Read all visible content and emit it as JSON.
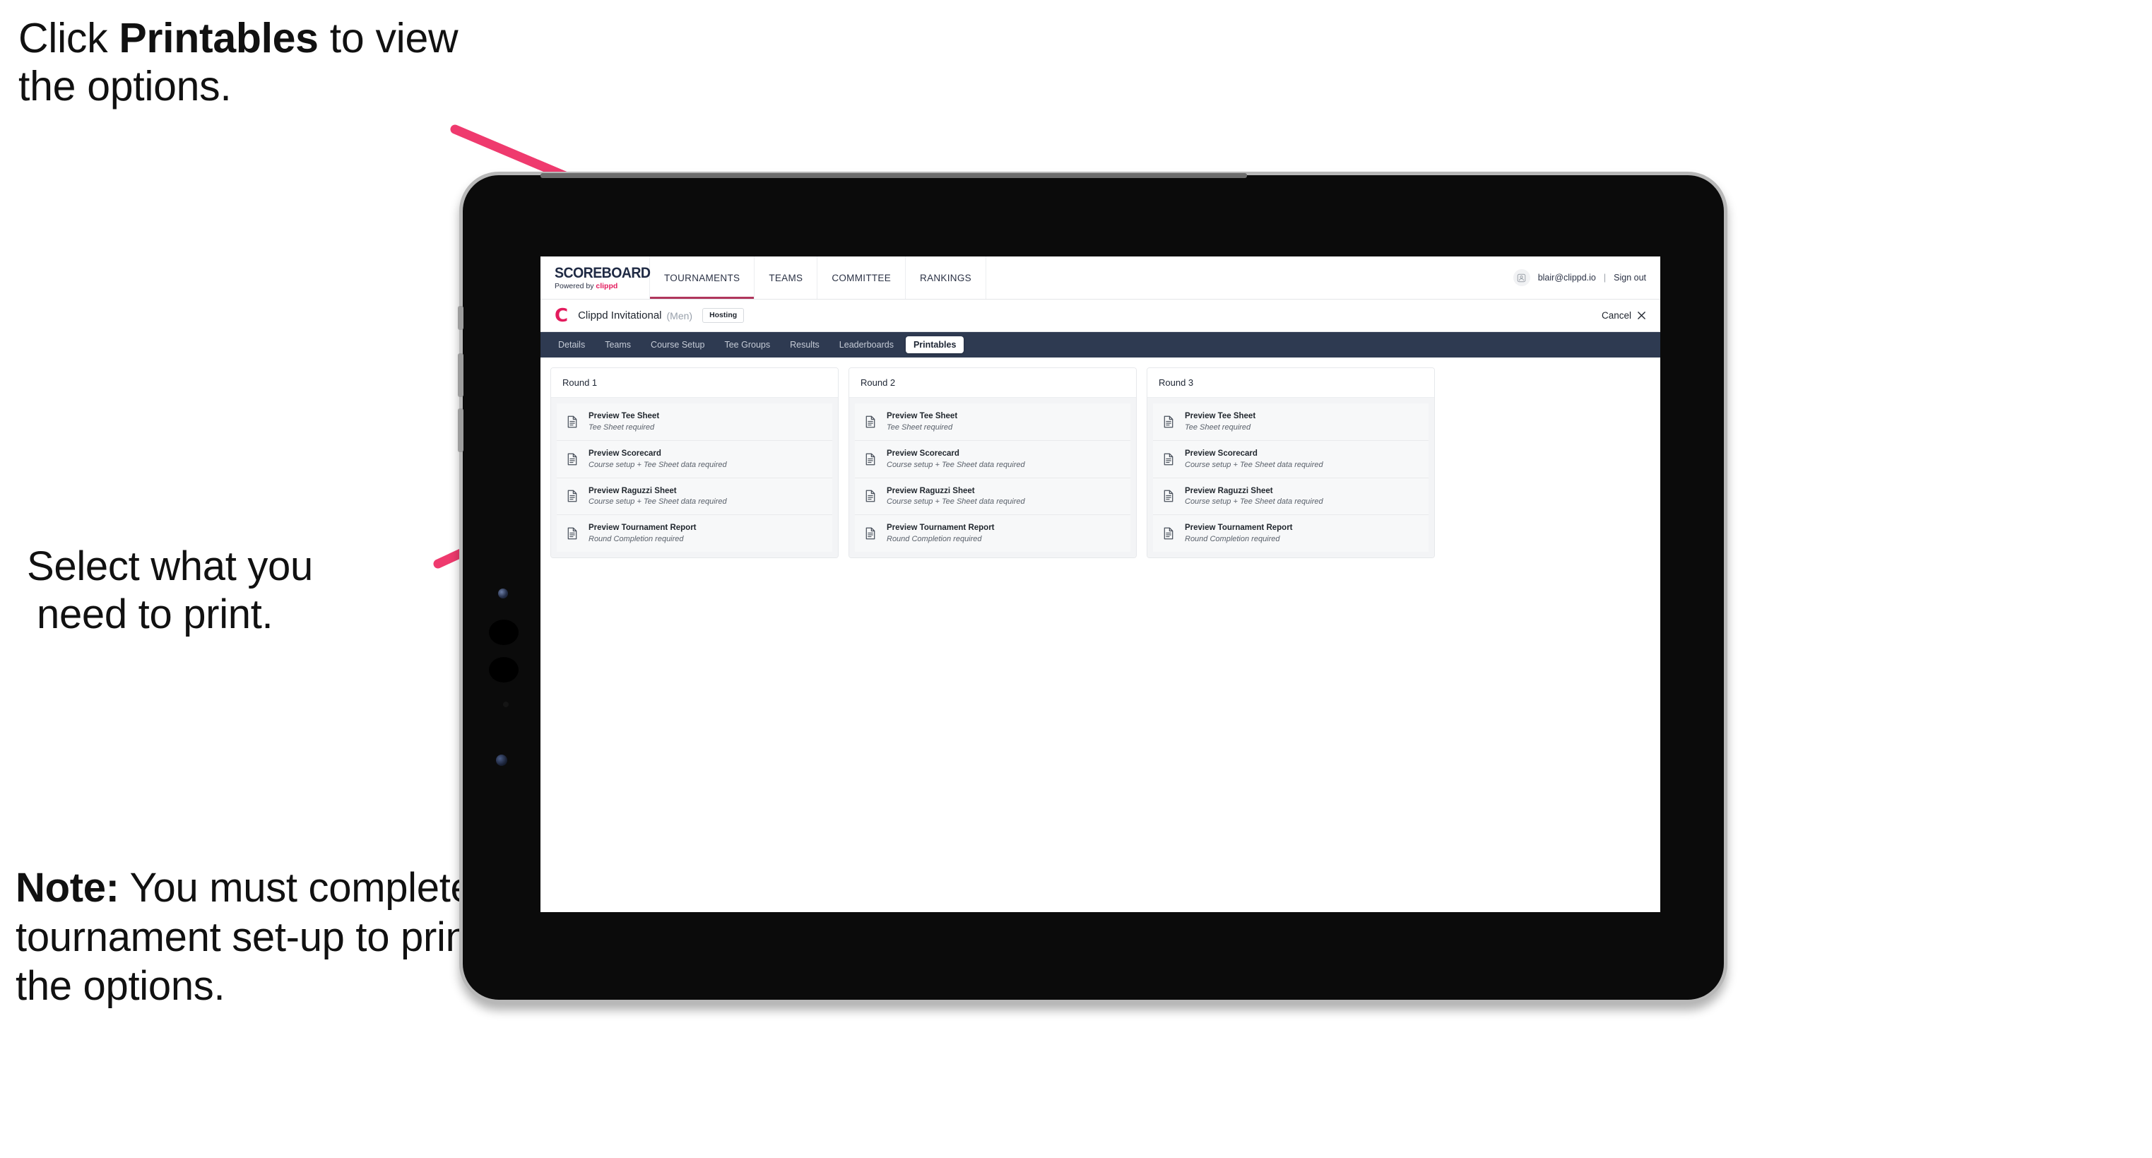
{
  "annotations": {
    "click_prefix": "Click ",
    "click_bold": "Printables",
    "click_suffix": " to view the options.",
    "select_line1": "Select what you",
    "select_line2": "need to print.",
    "note_bold": "Note:",
    "note_text": " You must complete the tournament set-up to print all the options."
  },
  "arrows": {
    "color": "#ef3a6e",
    "arrow1_name": "arrow-to-printables-tab",
    "arrow2_name": "arrow-to-printables-list"
  },
  "browser": {
    "header": {
      "logo_word": "SCOREBOARD",
      "logo_sub_prefix": "Powered by ",
      "logo_sub_brand": "clippd",
      "nav": [
        {
          "label": "TOURNAMENTS",
          "active": true
        },
        {
          "label": "TEAMS",
          "active": false
        },
        {
          "label": "COMMITTEE",
          "active": false
        },
        {
          "label": "RANKINGS",
          "active": false
        }
      ],
      "avatar_icon": "user-avatar-icon",
      "user_email": "blair@clippd.io",
      "separator": "|",
      "sign_out": "Sign out"
    },
    "title_bar": {
      "brand_mark": "C",
      "tournament_name": "Clippd Invitational",
      "gender": "(Men)",
      "badge": "Hosting",
      "cancel_label": "Cancel",
      "cancel_icon": "close-icon"
    },
    "tabs": [
      {
        "label": "Details",
        "active": false
      },
      {
        "label": "Teams",
        "active": false
      },
      {
        "label": "Course Setup",
        "active": false
      },
      {
        "label": "Tee Groups",
        "active": false
      },
      {
        "label": "Results",
        "active": false
      },
      {
        "label": "Leaderboards",
        "active": false
      },
      {
        "label": "Printables",
        "active": true
      }
    ],
    "rounds": [
      {
        "title": "Round 1",
        "items": [
          {
            "title": "Preview Tee Sheet",
            "sub": "Tee Sheet required"
          },
          {
            "title": "Preview Scorecard",
            "sub": "Course setup + Tee Sheet data required"
          },
          {
            "title": "Preview Raguzzi Sheet",
            "sub": "Course setup + Tee Sheet data required"
          },
          {
            "title": "Preview Tournament Report",
            "sub": "Round Completion required"
          }
        ]
      },
      {
        "title": "Round 2",
        "items": [
          {
            "title": "Preview Tee Sheet",
            "sub": "Tee Sheet required"
          },
          {
            "title": "Preview Scorecard",
            "sub": "Course setup + Tee Sheet data required"
          },
          {
            "title": "Preview Raguzzi Sheet",
            "sub": "Course setup + Tee Sheet data required"
          },
          {
            "title": "Preview Tournament Report",
            "sub": "Round Completion required"
          }
        ]
      },
      {
        "title": "Round 3",
        "items": [
          {
            "title": "Preview Tee Sheet",
            "sub": "Tee Sheet required"
          },
          {
            "title": "Preview Scorecard",
            "sub": "Course setup + Tee Sheet data required"
          },
          {
            "title": "Preview Raguzzi Sheet",
            "sub": "Course setup + Tee Sheet data required"
          },
          {
            "title": "Preview Tournament Report",
            "sub": "Round Completion required"
          }
        ]
      }
    ]
  },
  "colors": {
    "accent_pink": "#e31b5d",
    "arrow_pink": "#ef3a6e",
    "tab_strip": "#2e3a51",
    "nav_active_underline": "#b0365c"
  }
}
